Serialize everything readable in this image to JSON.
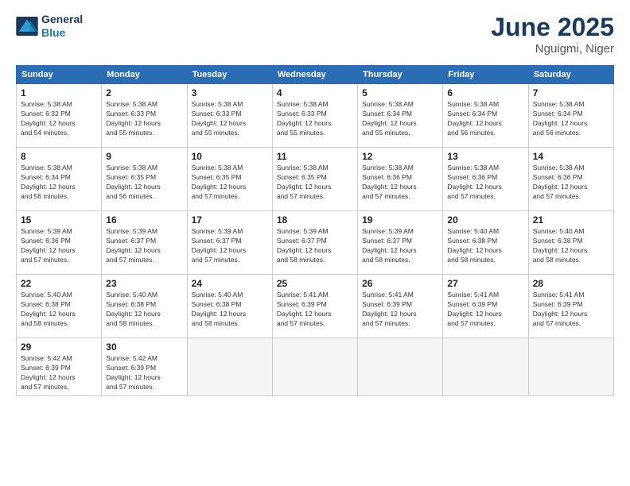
{
  "header": {
    "logo_line1": "General",
    "logo_line2": "Blue",
    "month_year": "June 2025",
    "location": "Nguigmi, Niger"
  },
  "days_of_week": [
    "Sunday",
    "Monday",
    "Tuesday",
    "Wednesday",
    "Thursday",
    "Friday",
    "Saturday"
  ],
  "weeks": [
    [
      {
        "day": "1",
        "info": "Sunrise: 5:38 AM\nSunset: 6:32 PM\nDaylight: 12 hours\nand 54 minutes."
      },
      {
        "day": "2",
        "info": "Sunrise: 5:38 AM\nSunset: 6:33 PM\nDaylight: 12 hours\nand 55 minutes."
      },
      {
        "day": "3",
        "info": "Sunrise: 5:38 AM\nSunset: 6:33 PM\nDaylight: 12 hours\nand 55 minutes."
      },
      {
        "day": "4",
        "info": "Sunrise: 5:38 AM\nSunset: 6:33 PM\nDaylight: 12 hours\nand 55 minutes."
      },
      {
        "day": "5",
        "info": "Sunrise: 5:38 AM\nSunset: 6:34 PM\nDaylight: 12 hours\nand 55 minutes."
      },
      {
        "day": "6",
        "info": "Sunrise: 5:38 AM\nSunset: 6:34 PM\nDaylight: 12 hours\nand 56 minutes."
      },
      {
        "day": "7",
        "info": "Sunrise: 5:38 AM\nSunset: 6:34 PM\nDaylight: 12 hours\nand 56 minutes."
      }
    ],
    [
      {
        "day": "8",
        "info": "Sunrise: 5:38 AM\nSunset: 6:34 PM\nDaylight: 12 hours\nand 56 minutes."
      },
      {
        "day": "9",
        "info": "Sunrise: 5:38 AM\nSunset: 6:35 PM\nDaylight: 12 hours\nand 56 minutes."
      },
      {
        "day": "10",
        "info": "Sunrise: 5:38 AM\nSunset: 6:35 PM\nDaylight: 12 hours\nand 57 minutes."
      },
      {
        "day": "11",
        "info": "Sunrise: 5:38 AM\nSunset: 6:35 PM\nDaylight: 12 hours\nand 57 minutes."
      },
      {
        "day": "12",
        "info": "Sunrise: 5:38 AM\nSunset: 6:36 PM\nDaylight: 12 hours\nand 57 minutes."
      },
      {
        "day": "13",
        "info": "Sunrise: 5:38 AM\nSunset: 6:36 PM\nDaylight: 12 hours\nand 57 minutes."
      },
      {
        "day": "14",
        "info": "Sunrise: 5:38 AM\nSunset: 6:36 PM\nDaylight: 12 hours\nand 57 minutes."
      }
    ],
    [
      {
        "day": "15",
        "info": "Sunrise: 5:39 AM\nSunset: 6:36 PM\nDaylight: 12 hours\nand 57 minutes."
      },
      {
        "day": "16",
        "info": "Sunrise: 5:39 AM\nSunset: 6:37 PM\nDaylight: 12 hours\nand 57 minutes."
      },
      {
        "day": "17",
        "info": "Sunrise: 5:39 AM\nSunset: 6:37 PM\nDaylight: 12 hours\nand 57 minutes."
      },
      {
        "day": "18",
        "info": "Sunrise: 5:39 AM\nSunset: 6:37 PM\nDaylight: 12 hours\nand 58 minutes."
      },
      {
        "day": "19",
        "info": "Sunrise: 5:39 AM\nSunset: 6:37 PM\nDaylight: 12 hours\nand 58 minutes."
      },
      {
        "day": "20",
        "info": "Sunrise: 5:40 AM\nSunset: 6:38 PM\nDaylight: 12 hours\nand 58 minutes."
      },
      {
        "day": "21",
        "info": "Sunrise: 5:40 AM\nSunset: 6:38 PM\nDaylight: 12 hours\nand 58 minutes."
      }
    ],
    [
      {
        "day": "22",
        "info": "Sunrise: 5:40 AM\nSunset: 6:38 PM\nDaylight: 12 hours\nand 58 minutes."
      },
      {
        "day": "23",
        "info": "Sunrise: 5:40 AM\nSunset: 6:38 PM\nDaylight: 12 hours\nand 58 minutes."
      },
      {
        "day": "24",
        "info": "Sunrise: 5:40 AM\nSunset: 6:38 PM\nDaylight: 12 hours\nand 58 minutes."
      },
      {
        "day": "25",
        "info": "Sunrise: 5:41 AM\nSunset: 6:39 PM\nDaylight: 12 hours\nand 57 minutes."
      },
      {
        "day": "26",
        "info": "Sunrise: 5:41 AM\nSunset: 6:39 PM\nDaylight: 12 hours\nand 57 minutes."
      },
      {
        "day": "27",
        "info": "Sunrise: 5:41 AM\nSunset: 6:39 PM\nDaylight: 12 hours\nand 57 minutes."
      },
      {
        "day": "28",
        "info": "Sunrise: 5:41 AM\nSunset: 6:39 PM\nDaylight: 12 hours\nand 57 minutes."
      }
    ],
    [
      {
        "day": "29",
        "info": "Sunrise: 5:42 AM\nSunset: 6:39 PM\nDaylight: 12 hours\nand 57 minutes."
      },
      {
        "day": "30",
        "info": "Sunrise: 5:42 AM\nSunset: 6:39 PM\nDaylight: 12 hours\nand 57 minutes."
      },
      {
        "day": "",
        "info": ""
      },
      {
        "day": "",
        "info": ""
      },
      {
        "day": "",
        "info": ""
      },
      {
        "day": "",
        "info": ""
      },
      {
        "day": "",
        "info": ""
      }
    ]
  ]
}
